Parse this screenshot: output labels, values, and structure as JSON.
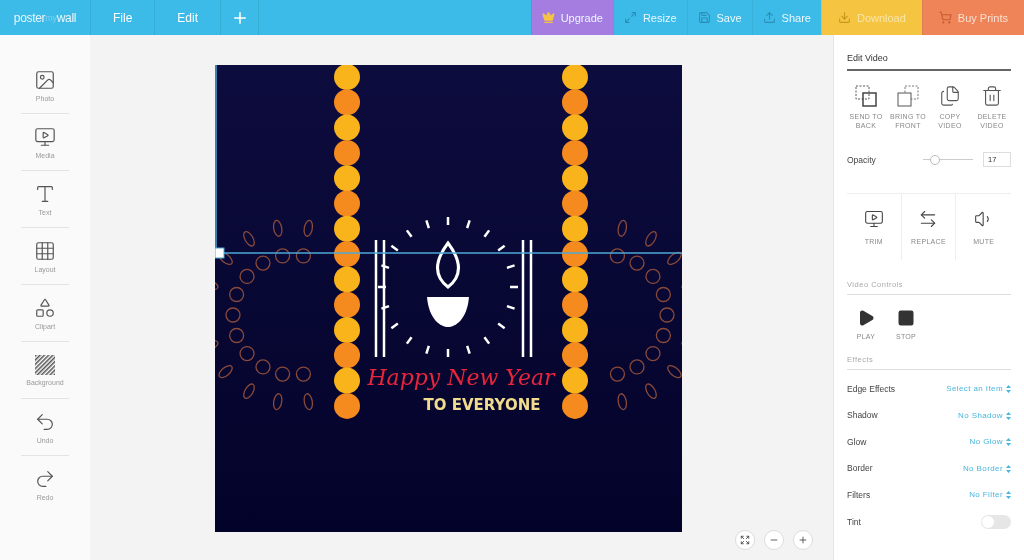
{
  "topbar": {
    "logo": {
      "first": "poster",
      "accent": "my",
      "last": "wall"
    },
    "menu": [
      "File",
      "Edit"
    ],
    "actions": [
      {
        "label": "Upgrade",
        "kind": "upgrade",
        "color": "#a57ce0"
      },
      {
        "label": "Resize",
        "kind": "resize",
        "color": "#3dbbe8"
      },
      {
        "label": "Save",
        "kind": "save",
        "color": "#3dbbe8"
      },
      {
        "label": "Share",
        "kind": "share",
        "color": "#3dbbe8"
      },
      {
        "label": "Download",
        "kind": "download",
        "color": "#f5c440"
      },
      {
        "label": "Buy Prints",
        "kind": "cart",
        "color": "#ef8459"
      }
    ]
  },
  "sidebar": {
    "items": [
      {
        "label": "Photo",
        "kind": "photo"
      },
      {
        "label": "Media",
        "kind": "media"
      },
      {
        "label": "Text",
        "kind": "text"
      },
      {
        "label": "Layout",
        "kind": "layout"
      },
      {
        "label": "Clipart",
        "kind": "clipart"
      },
      {
        "label": "Background",
        "kind": "background"
      },
      {
        "label": "Undo",
        "kind": "undo"
      },
      {
        "label": "Redo",
        "kind": "redo"
      }
    ]
  },
  "poster": {
    "title": "Happy New Year",
    "subtitle": "TO EVERYONE"
  },
  "panel": {
    "title": "Edit Video",
    "arrange": [
      {
        "label": "SEND TO BACK",
        "kind": "back"
      },
      {
        "label": "BRING TO FRONT",
        "kind": "front"
      },
      {
        "label": "COPY VIDEO",
        "kind": "copy"
      },
      {
        "label": "DELETE VIDEO",
        "kind": "delete"
      }
    ],
    "opacity": {
      "label": "Opacity",
      "level": 0.17,
      "value": "17"
    },
    "media": [
      {
        "label": "TRIM",
        "kind": "trim"
      },
      {
        "label": "REPLACE",
        "kind": "replace"
      },
      {
        "label": "MUTE",
        "kind": "mute"
      }
    ],
    "controls_title": "Video Controls",
    "controls": [
      {
        "label": "PLAY",
        "kind": "play"
      },
      {
        "label": "STOP",
        "kind": "stop"
      }
    ],
    "effects_title": "Effects",
    "effects": [
      {
        "label": "Edge Effects",
        "value": "Select an Item"
      },
      {
        "label": "Shadow",
        "value": "No Shadow"
      },
      {
        "label": "Glow",
        "value": "No Glow"
      },
      {
        "label": "Border",
        "value": "No Border"
      },
      {
        "label": "Filters",
        "value": "No Filter"
      }
    ],
    "tint": {
      "label": "Tint",
      "on": false
    }
  }
}
